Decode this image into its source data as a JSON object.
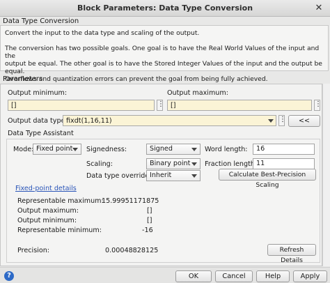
{
  "window": {
    "title": "Block Parameters: Data Type Conversion",
    "close_glyph": "✕"
  },
  "description": {
    "group_title": "Data Type Conversion",
    "line1": "Convert the input to the data type and scaling of the output.",
    "para2_l1": "The conversion has two possible goals. One goal is to have the Real World Values of the input and the",
    "para2_l2": "output be equal.  The other goal is to have the Stored Integer Values of the input and the output be equal.",
    "para2_l3": "Overflows and quantization errors can prevent the goal from being fully achieved."
  },
  "parameters": {
    "group_title": "Parameters",
    "output_min_label": "Output minimum:",
    "output_min_value": "[]",
    "output_max_label": "Output maximum:",
    "output_max_value": "[]",
    "dots": "⋮",
    "output_dtype_label": "Output data type:",
    "output_dtype_value": "fixdt(1,16,11)",
    "assistant_toggle_label": "<<"
  },
  "assistant": {
    "title": "Data Type Assistant",
    "mode_label": "Mode:",
    "mode_value": "Fixed point",
    "signedness_label": "Signedness:",
    "signedness_value": "Signed",
    "word_length_label": "Word length:",
    "word_length_value": "16",
    "scaling_label": "Scaling:",
    "scaling_value": "Binary point",
    "fraction_length_label": "Fraction length:",
    "fraction_length_value": "11",
    "override_label": "Data type override:",
    "override_value": "Inherit",
    "calc_button": "Calculate Best-Precision Scaling",
    "details_link": "Fixed-point details",
    "details": {
      "rep_max_label": "Representable maximum:",
      "rep_max_value": "15.99951171875",
      "out_max_label": "Output maximum:",
      "out_max_value": "[]",
      "out_min_label": "Output minimum:",
      "out_min_value": "[]",
      "rep_min_label": "Representable minimum:",
      "rep_min_value": "-16",
      "precision_label": "Precision:",
      "precision_value": "0.00048828125",
      "refresh_button": "Refresh Details"
    }
  },
  "footer": {
    "help_glyph": "?",
    "ok": "OK",
    "cancel": "Cancel",
    "help": "Help",
    "apply": "Apply"
  },
  "colors": {
    "field_bg": "#fbf4d6",
    "link": "#2a55b8",
    "help_icon": "#2d6ac7"
  }
}
